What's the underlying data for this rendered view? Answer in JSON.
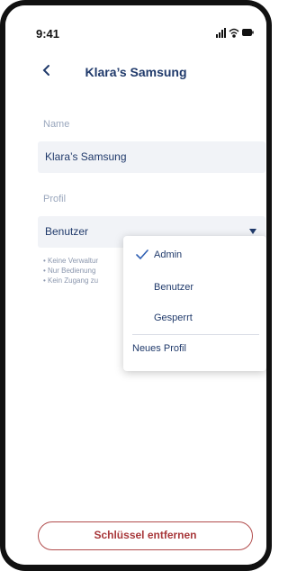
{
  "status_bar": {
    "time": "9:41",
    "icons": [
      "signal-icon",
      "wifi-icon",
      "battery-icon"
    ]
  },
  "nav": {
    "back_icon": "chevron-left-icon",
    "title": "Klara’s Samsung"
  },
  "form": {
    "name_label": "Name",
    "name_value": "Klara’s Samsung",
    "profile_label": "Profil",
    "profile_value": "Benutzer"
  },
  "permissions": [
    "• Keine Verwaltur",
    "• Nur Bedienung",
    "• Kein Zugang zu"
  ],
  "menu": {
    "items": [
      {
        "label": "Admin",
        "selected": true
      },
      {
        "label": "Benutzer",
        "selected": false
      },
      {
        "label": "Gesperrt",
        "selected": false
      }
    ],
    "new_profile": "Neues Profil"
  },
  "actions": {
    "remove_key": "Schlüssel entfernen"
  },
  "colors": {
    "primary": "#203a6b",
    "danger": "#a8383b",
    "field_bg": "#f1f3f7",
    "accent": "#2f5fb3"
  }
}
